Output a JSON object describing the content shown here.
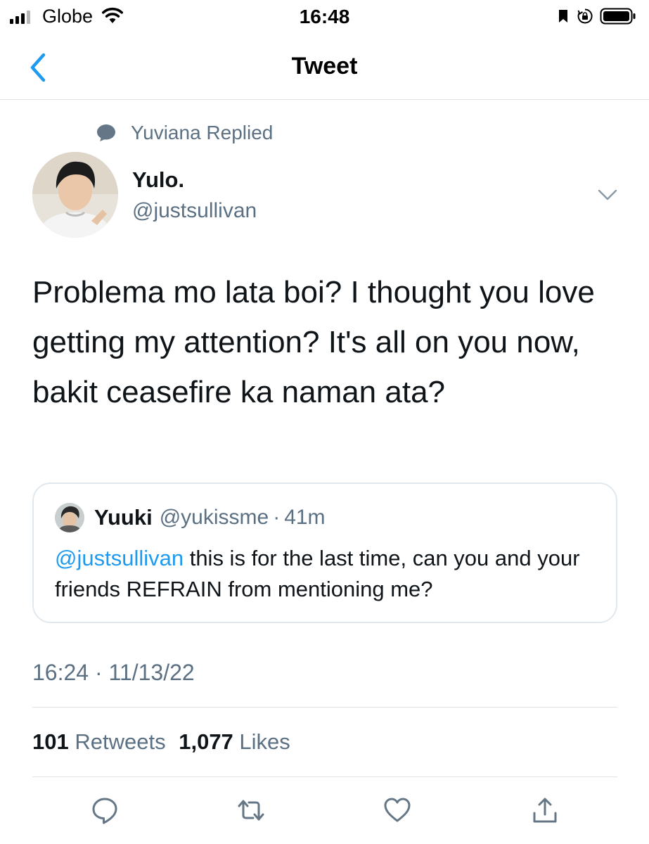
{
  "status_bar": {
    "carrier": "Globe",
    "time": "16:48",
    "icons": [
      "signal-icon",
      "wifi-icon",
      "bookmark-icon",
      "rotation-lock-icon",
      "battery-icon"
    ]
  },
  "header": {
    "title": "Tweet",
    "back_icon": "chevron-left-icon"
  },
  "context": {
    "label": "Yuviana Replied",
    "icon": "speech-bubble-icon"
  },
  "tweet": {
    "author_name": "Yulo.",
    "author_handle": "@justsullivan",
    "text": "Problema mo lata boi? I thought you love getting my attention? It's all on you now, bakit ceasefire ka naman ata?",
    "timestamp": "16:24 · 11/13/22"
  },
  "quote": {
    "name": "Yuuki",
    "handle": "@yukissme",
    "separator": "·",
    "age": "41m",
    "mention": "@justsullivan",
    "text": " this is for the last time, can you and your friends REFRAIN from mentioning me?"
  },
  "stats": {
    "retweets_count": "101",
    "retweets_label": "Retweets",
    "likes_count": "1,077",
    "likes_label": "Likes"
  },
  "actions": [
    "reply-icon",
    "retweet-icon",
    "like-icon",
    "share-icon"
  ],
  "colors": {
    "accent": "#1d9bf0",
    "secondary_text": "#5b7083",
    "border": "#e1e8ed",
    "icon_gray": "#657786"
  }
}
